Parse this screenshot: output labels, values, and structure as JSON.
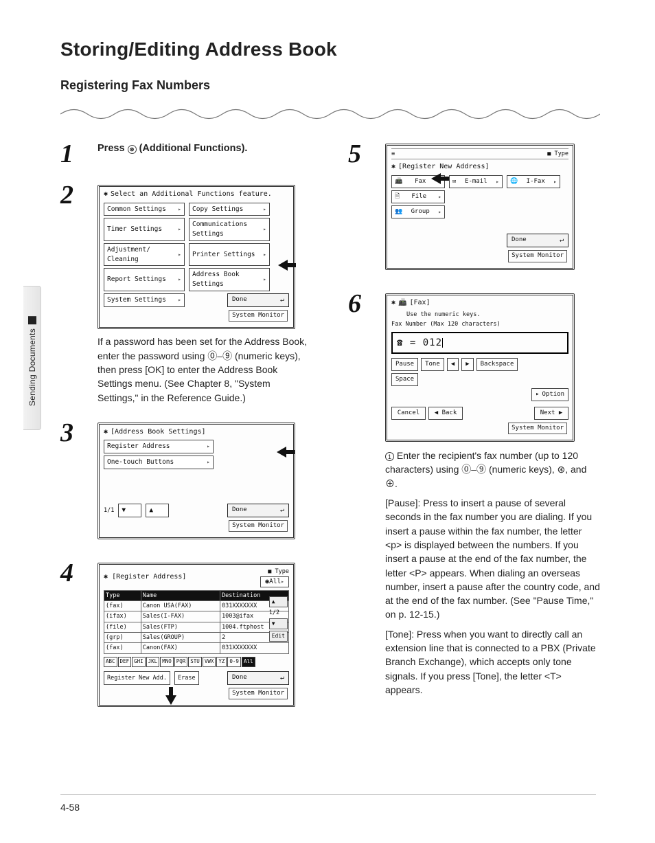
{
  "sidebar_label": "Sending Documents",
  "title": "Storing/Editing Address Book",
  "subhead": "Registering Fax Numbers",
  "page_number": "4-58",
  "step1": {
    "text_prefix": "Press ",
    "key_icon_alt": "Additional Functions key",
    "text_suffix": " (Additional Functions)."
  },
  "step2_note": "If a password has been set for the Address Book, enter the password using ⓪–⑨ (numeric keys), then press [OK] to enter the Address Book Settings menu. (See Chapter 8, \"System Settings,\" in the Reference Guide.)",
  "screen2": {
    "title": "Select an Additional Functions feature.",
    "items": [
      [
        "Common Settings",
        "Copy Settings"
      ],
      [
        "Timer Settings",
        "Communications Settings"
      ],
      [
        "Adjustment/ Cleaning",
        "Printer Settings"
      ],
      [
        "Report Settings",
        "Address Book Settings"
      ],
      [
        "System Settings",
        ""
      ]
    ],
    "done": "Done",
    "system_monitor": "System Monitor"
  },
  "screen3": {
    "title": "[Address Book Settings]",
    "items": [
      "Register Address",
      "One-touch Buttons"
    ],
    "page": "1/1",
    "done": "Done",
    "system_monitor": "System Monitor"
  },
  "screen4": {
    "title": "[Register Address]",
    "type_lbl": "■ Type",
    "type_all": "All",
    "columns": [
      "Type",
      "Name",
      "Destination"
    ],
    "rows": [
      [
        "(fax)",
        "Canon USA(FAX)",
        "031XXXXXXX"
      ],
      [
        "(ifax)",
        "Sales(I-FAX)",
        "1003@ifax"
      ],
      [
        "(file)",
        "Sales(FTP)",
        "1004.ftphost"
      ],
      [
        "(grp)",
        "Sales(GROUP)",
        "2"
      ],
      [
        "(fax)",
        "Canon(FAX)",
        "031XXXXXXX"
      ]
    ],
    "page": "1/2",
    "alpha": [
      "ABC",
      "DEF",
      "GHI",
      "JKL",
      "MNO",
      "PQR",
      "STU",
      "VWX",
      "YZ",
      "0-9",
      "All"
    ],
    "register_new": "Register New Add.",
    "erase": "Erase",
    "done": "Done",
    "edit": "Edit",
    "system_monitor": "System Monitor"
  },
  "screen5": {
    "title": "[Register New Address]",
    "buttons": [
      "Fax",
      "E-mail",
      "I-Fax",
      "File",
      "Group"
    ],
    "done": "Done",
    "system_monitor": "System Monitor"
  },
  "screen6": {
    "title": "[Fax]",
    "hint": "Use the numeric keys.",
    "sublabel": "Fax Number (Max 120 characters)",
    "value_prefix": "☎ = ",
    "value": "012",
    "keys": [
      "Pause",
      "Tone",
      "◀",
      "▶",
      "Backspace",
      "Space"
    ],
    "option": "Option",
    "cancel": "Cancel",
    "back": "Back",
    "next": "Next",
    "system_monitor": "System Monitor"
  },
  "step6_para": {
    "line1": "Enter the recipient's fax number (up to 120 characters) using ⓪–⑨ (numeric keys), ⊛, and ⊕.",
    "pause": "[Pause]: Press to insert a pause of several seconds in the fax number you are dialing. If you insert a pause within the fax number, the letter <p> is displayed between the numbers. If you insert a pause at the end of the fax number, the letter <P> appears. When dialing an overseas number, insert a pause after the country code, and at the end of the fax number. (See \"Pause Time,\" on p. 12-15.)",
    "tone": "[Tone]: Press when you want to directly call an extension line that is connected to a PBX (Private Branch Exchange), which accepts only tone signals. If you press [Tone], the letter <T> appears."
  }
}
